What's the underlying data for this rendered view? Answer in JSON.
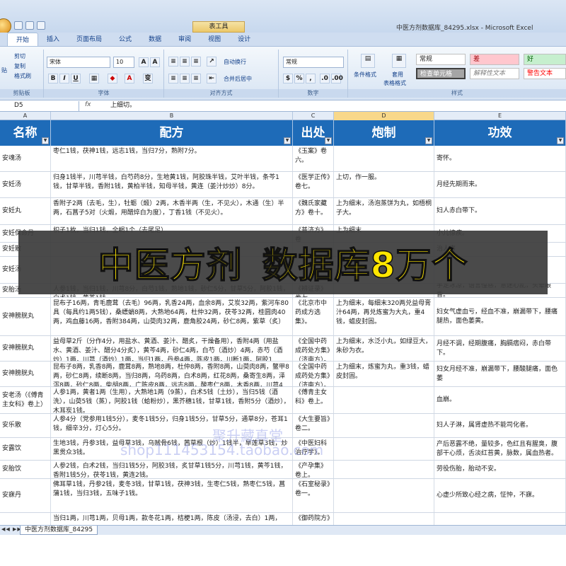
{
  "window": {
    "title": "中医方剂数据库_84295.xlsx - Microsoft Excel",
    "context_tab": "表工具"
  },
  "ribbon": {
    "tabs": [
      "开始",
      "插入",
      "页面布局",
      "公式",
      "数据",
      "审阅",
      "视图",
      "设计"
    ],
    "clipboard": {
      "cut": "剪切",
      "copy": "复制",
      "format_painter": "格式刷",
      "paste": "贴",
      "label": "剪贴板"
    },
    "font": {
      "name": "宋体",
      "size": "10",
      "label": "字体"
    },
    "alignment": {
      "wrap": "自动换行",
      "merge": "合并后居中",
      "label": "对齐方式"
    },
    "number": {
      "format": "常规",
      "label": "数字"
    },
    "styles": {
      "conditional": "条件格式",
      "table": "套用",
      "table2": "表格格式",
      "normal": "常规",
      "bad": "差",
      "good": "好",
      "check": "检查单元格",
      "explain": "解释性文本",
      "warn": "警告文本",
      "label": "样式"
    }
  },
  "formula_bar": {
    "cell_ref": "D5",
    "fx": "fx",
    "value": "上细切。"
  },
  "columns": [
    "A",
    "B",
    "C",
    "D",
    "E"
  ],
  "headers": [
    "名称",
    "配方",
    "出处",
    "炮制",
    "功效"
  ],
  "rows": [
    {
      "name": "安魂汤",
      "recipe": "枣仁1钱，茯神1钱，远志1钱，当归7分，熟附7分。",
      "source": "《玉案》卷六。",
      "prep": "",
      "effect": "寄怀。"
    },
    {
      "name": "安妊汤",
      "recipe": "归身1钱半，川芎半钱，白芍药8分，生地黄1钱，阿胶珠半钱，艾叶半钱，条芩1钱，甘草半钱，香附1钱，黄柏半钱，知母半钱，黄连（姜汁炒炒）8分。",
      "source": "《医学正传》卷七。",
      "prep": "上切，作一服。",
      "effect": "月经先期而来。"
    },
    {
      "name": "安妊丸",
      "recipe": "香附子2两（去毛，生），牡蛎（煅）2两，木香半两（生，不见火），木通（生）半两，石菖子5对（火煅，用醋焠白为度），丁香1钱（不见火）。",
      "source": "《魏氏家藏方》卷十。",
      "prep": "上为细末，汤泡蒸饼为丸，如梧桐子大。",
      "effect": "妇人赤白带下。"
    },
    {
      "name": "安妊保命丹",
      "recipe": "枳子1枚，当归1钱，全蝎1个（去尾足）",
      "source": "《普济方》卷",
      "prep": "上为细末",
      "effect": "小儿惊疾。"
    },
    {
      "name": "安妊散",
      "recipe": "",
      "source": "",
      "prep": "",
      "effect": "治人事"
    },
    {
      "name": "安妊汤",
      "recipe": "",
      "source": "",
      "prep": "",
      "effect": ""
    },
    {
      "name": "安胎汤",
      "recipe": "人参1钱，当归1钱，川芎8分，白芍1钱，熟地1钱，砂仁5分，甘草5分，阿胶1钱，白术1钱，黄芩1钱。",
      "source": "《辨证录》卷七。",
      "prep": "",
      "effect": "手足冰凉，语言惶惑，意迷心乱，头晕眼昏。"
    },
    {
      "name": "安神膀胱丸",
      "recipe": "昆布子16两，青毛鹿茸（去毛）96两，乳香24两，血余8两，艾炭32两，紫河车80具（每具约1两5钱），桑螵蛸8两，大熟地64两，杜仲32两，茯苓32两，桂圆肉40两，鸡血藤16两，香附384两，山萸肉32两，鹿角胶24两，砂仁8两，紫草（炙）",
      "source": "《北京市中药成方选集》。",
      "prep": "上为细末，每细末320两兑益母膏汁64两，再兑炼蜜为大丸，重4钱，蜡皮封固。",
      "effect": "妇女气虚血亏，经血不准，崩漏带下，腰痛腿热，面色萎黄。"
    },
    {
      "name": "安神膀胱丸",
      "recipe": "益母草2斤（分作4分，用盐水、黄酒、姜汁、醋炙，干燥备用），香附4两（用盐水、黄酒、姜汁、醋分4分炙），黄芩4两，砂仁4两，白芍（酒炒）4两，赤芍（酒炒）1两，川芎（酒炒）1两，当归1两，丹参4两，陈皮1两，川断1两，阿胶1",
      "source": "《全国中药成药处方集》（济南方）。",
      "prep": "上为细末，水泛小丸，如绿豆大，朱砂为衣。",
      "effect": "月经不调，经期腹痛，胸膈痞闷，赤白带下。"
    },
    {
      "name": "安神膀胱丸",
      "recipe": "昆布子8两，乳香8两，鹿茸8两，熟地8两，杜仲8两，香附8两，山萸肉8两，鳖甲8两，砂仁8两，续断8两，当归8两，乌药8两，白术8两，红花8两，桑寄生8两，泽泻8两，砂仁8两，柴胡8两，广陈皮8两，远志8两，酸枣仁8两，木香8两，川芎4",
      "source": "《全国中药成药处方集》（济南方）。",
      "prep": "上为细末，炼蜜为丸，重3钱，蜡皮封固。",
      "effect": "妇女月经不准，崩漏带下，腰酸腿痛，面色萎"
    },
    {
      "name": "安老汤（《傅青主女科》卷上）",
      "recipe": "人参1两，黄者1两（生用），大熟地1两（9蒸），白术5钱（土炒），当归5钱（酒洗），山萸5钱（蒸），阿胶1钱（蛤粉炒），黑芥穗1钱，甘草1钱，香附5分（酒炒），木耳炭1钱。",
      "source": "《傅青主女科》卷上。",
      "prep": "",
      "effect": "血崩。"
    },
    {
      "name": "安乐散",
      "recipe": "人参4分（党参用1钱5分），麦冬1钱5分，归身1钱5分，甘草5分，通草8分，苍耳1钱，细辛3分，灯心5分。",
      "source": "《大生要旨》卷二。",
      "prep": "",
      "effect": "妇人子淋，属肾虚热不能司化者。"
    },
    {
      "name": "安露饮",
      "recipe": "生地3钱，丹参3钱，益母草3钱，乌贼骨6钱，茜草根（炒）1钱半，旱莲草3钱，炒黑贯众3钱。",
      "source": "《中医妇科治疗学》。",
      "prep": "",
      "effect": "产后恶露不绝，量较多，色红且有腥臭，腹部干心烦，舌淡红苔黄，脉数，属血热者。"
    },
    {
      "name": "安胎饮",
      "recipe": "人参2钱，白术2钱，当归1钱5分，阿胶3钱，炙甘草1钱5分，川芎1钱，黄芩1钱，香附1钱5分，茯苓1钱，黄连2钱。",
      "source": "《产孕集》卷上。",
      "prep": "",
      "effect": "劳役伤胎，胎动不安。"
    },
    {
      "name": "安寐丹",
      "recipe": "佛耳草1钱，丹参2钱，麦冬3钱，甘草1钱，茯神3钱，生枣仁5钱，熟枣仁5钱，菖蒲1钱，当归3钱，五味子1钱。",
      "source": "《石室秘录》卷一。",
      "prep": "",
      "effect": "心虚少所致心经之病，怔忡，不寐。"
    },
    {
      "name": "",
      "recipe": "当归1两，川芎1两，贝母1两，款冬花1两，桔梗1两，陈皮（汤浸，去白）1两，",
      "source": "《御药院方》",
      "prep": "",
      "effect": ""
    }
  ],
  "banner": {
    "part1": "中医方剂",
    "part2": "数据库8万个"
  },
  "watermark": {
    "line1": "聚升藏真堂",
    "line2": "shop111453154.taobao.com"
  },
  "sheet_tab": "中医方剂数据库_84295"
}
